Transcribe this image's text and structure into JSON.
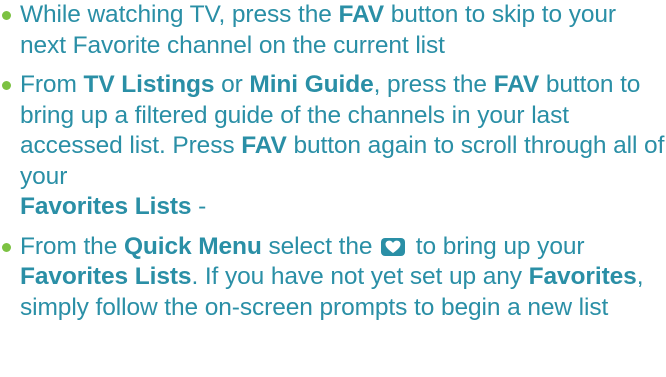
{
  "colors": {
    "text": "#2a8fa6",
    "bullet": "#7cc242",
    "heart_icon_bg": "#2a8fa6",
    "heart_icon_fg": "#ffffff"
  },
  "bullets": [
    {
      "t1": "While watching TV, press the ",
      "b1": "FAV",
      "t2": " button to skip to your next Favorite channel on the current list"
    },
    {
      "t1": "From ",
      "b1": "TV Listings",
      "t2": " or ",
      "b2": "Mini Guide",
      "t3": ", press the ",
      "b3": "FAV",
      "t4": " button to bring up a filtered guide of the channels in your last accessed list. Press ",
      "b4": "FAV",
      "t5": " button again to scroll through all of your ",
      "b5": "Favorites Lists",
      "t6": " -"
    },
    {
      "t1": "From the ",
      "b1": "Quick Menu",
      "t2": " select the ",
      "icon": "heart-icon",
      "t3": " to bring up your ",
      "b2": "Favorites Lists",
      "t4": ". If you have not yet set up any ",
      "b3": "Favorites",
      "t5": ", simply follow the on-screen prompts to begin a new list"
    }
  ]
}
